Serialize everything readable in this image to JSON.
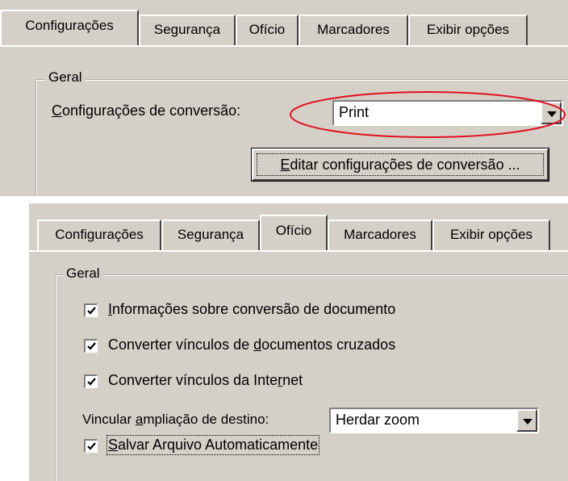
{
  "top_dialog": {
    "tabs": [
      "Configurações",
      "Segurança",
      "Ofício",
      "Marcadores",
      "Exibir opções"
    ],
    "active_tab": "Configurações",
    "group_title": "Geral",
    "conversion_label_prefix": "C",
    "conversion_label_rest": "onfigurações de conversão:",
    "conversion_value": "Print",
    "edit_button_prefix": "E",
    "edit_button_rest": "ditar configurações de conversão ...",
    "highlight_color": "#e01020"
  },
  "bottom_dialog": {
    "tabs": [
      "Configurações",
      "Segurança",
      "Ofício",
      "Marcadores",
      "Exibir opções"
    ],
    "active_tab": "Ofício",
    "group_title": "Geral",
    "checkbox1_a": "",
    "checkbox1_u": "I",
    "checkbox1_b": "nformações sobre conversão de documento",
    "checkbox2_a": "Converter vínculos de ",
    "checkbox2_u": "d",
    "checkbox2_b": "ocumentos cruzados",
    "checkbox3_a": "Converter vínculos da Inte",
    "checkbox3_u": "r",
    "checkbox3_b": "net",
    "zoom_label_a": "Vincular ",
    "zoom_label_u": "a",
    "zoom_label_b": "mpliação de destino:",
    "zoom_value": "Herdar zoom",
    "checkbox4_u": "S",
    "checkbox4_b": "alvar Arquivo Automaticamente",
    "checked": [
      true,
      true,
      true,
      true
    ]
  }
}
